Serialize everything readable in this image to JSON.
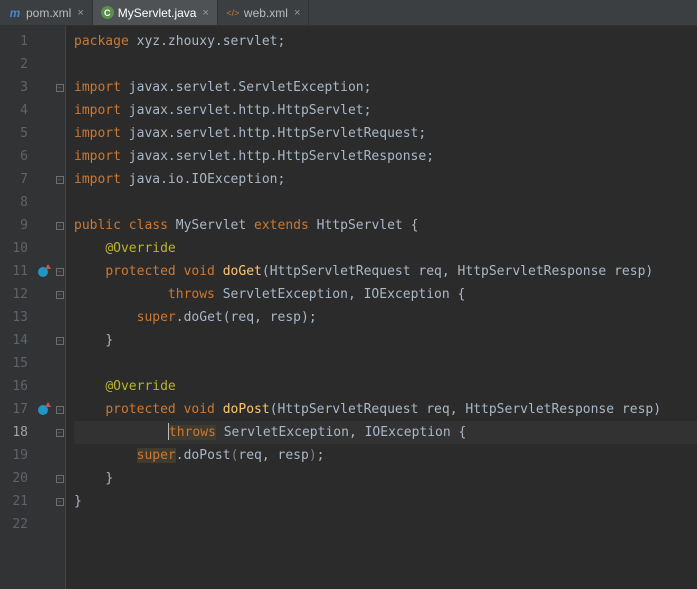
{
  "tabs": [
    {
      "label": "pom.xml",
      "icon": "m",
      "iconColor": "#4a86cf",
      "active": false
    },
    {
      "label": "MyServlet.java",
      "icon": "C",
      "iconColor": "#3b9f5a",
      "active": true
    },
    {
      "label": "web.xml",
      "icon": "xml",
      "iconColor": "#c57633",
      "active": false
    }
  ],
  "currentLine": 18,
  "lines": [
    {
      "n": 1,
      "gutter": "",
      "fold": "",
      "segs": [
        [
          "kw",
          "package "
        ],
        [
          "pkg",
          "xyz.zhouxy.servlet"
        ],
        [
          "punct",
          ";"
        ]
      ]
    },
    {
      "n": 2,
      "gutter": "",
      "fold": "",
      "segs": []
    },
    {
      "n": 3,
      "gutter": "",
      "fold": "fold",
      "segs": [
        [
          "kw",
          "import "
        ],
        [
          "pkg",
          "javax.servlet.ServletException"
        ],
        [
          "punct",
          ";"
        ]
      ]
    },
    {
      "n": 4,
      "gutter": "",
      "fold": "",
      "segs": [
        [
          "kw",
          "import "
        ],
        [
          "pkg",
          "javax.servlet.http.HttpServlet"
        ],
        [
          "punct",
          ";"
        ]
      ]
    },
    {
      "n": 5,
      "gutter": "",
      "fold": "",
      "segs": [
        [
          "kw",
          "import "
        ],
        [
          "pkg",
          "javax.servlet.http.HttpServletRequest"
        ],
        [
          "punct",
          ";"
        ]
      ]
    },
    {
      "n": 6,
      "gutter": "",
      "fold": "",
      "segs": [
        [
          "kw",
          "import "
        ],
        [
          "pkg",
          "javax.servlet.http.HttpServletResponse"
        ],
        [
          "punct",
          ";"
        ]
      ]
    },
    {
      "n": 7,
      "gutter": "",
      "fold": "fold",
      "segs": [
        [
          "kw",
          "import "
        ],
        [
          "pkg",
          "java.io.IOException"
        ],
        [
          "punct",
          ";"
        ]
      ]
    },
    {
      "n": 8,
      "gutter": "",
      "fold": "",
      "segs": []
    },
    {
      "n": 9,
      "gutter": "",
      "fold": "open",
      "segs": [
        [
          "kw",
          "public class "
        ],
        [
          "type",
          "MyServlet "
        ],
        [
          "kw",
          "extends "
        ],
        [
          "type",
          "HttpServlet "
        ],
        [
          "punct",
          "{"
        ]
      ]
    },
    {
      "n": 10,
      "gutter": "",
      "fold": "",
      "segs": [
        [
          "pkg",
          "    "
        ],
        [
          "anno",
          "@Override"
        ]
      ]
    },
    {
      "n": 11,
      "gutter": "override",
      "fold": "open",
      "segs": [
        [
          "pkg",
          "    "
        ],
        [
          "kw",
          "protected void "
        ],
        [
          "fn",
          "doGet"
        ],
        [
          "punct",
          "("
        ],
        [
          "type",
          "HttpServletRequest "
        ],
        [
          "param",
          "req"
        ],
        [
          "punct",
          ", "
        ],
        [
          "type",
          "HttpServletResponse "
        ],
        [
          "param",
          "resp"
        ],
        [
          "punct",
          ")"
        ]
      ]
    },
    {
      "n": 12,
      "gutter": "",
      "fold": "open",
      "segs": [
        [
          "pkg",
          "            "
        ],
        [
          "kw",
          "throws "
        ],
        [
          "type",
          "ServletException"
        ],
        [
          "punct",
          ", "
        ],
        [
          "type",
          "IOException "
        ],
        [
          "punct",
          "{"
        ]
      ]
    },
    {
      "n": 13,
      "gutter": "",
      "fold": "",
      "segs": [
        [
          "pkg",
          "        "
        ],
        [
          "kw",
          "super"
        ],
        [
          "punct",
          "."
        ],
        [
          "pkg",
          "doGet(req"
        ],
        [
          "punct",
          ", "
        ],
        [
          "pkg",
          "resp)"
        ],
        [
          "punct",
          ";"
        ]
      ]
    },
    {
      "n": 14,
      "gutter": "",
      "fold": "close",
      "segs": [
        [
          "pkg",
          "    "
        ],
        [
          "punct",
          "}"
        ]
      ]
    },
    {
      "n": 15,
      "gutter": "",
      "fold": "",
      "segs": []
    },
    {
      "n": 16,
      "gutter": "",
      "fold": "",
      "segs": [
        [
          "pkg",
          "    "
        ],
        [
          "anno",
          "@Override"
        ]
      ]
    },
    {
      "n": 17,
      "gutter": "override",
      "fold": "open",
      "segs": [
        [
          "pkg",
          "    "
        ],
        [
          "kw",
          "protected void "
        ],
        [
          "fn",
          "doPost"
        ],
        [
          "punct",
          "("
        ],
        [
          "type",
          "HttpServletRequest "
        ],
        [
          "param",
          "req"
        ],
        [
          "punct",
          ", "
        ],
        [
          "type",
          "HttpServletResponse "
        ],
        [
          "param",
          "resp"
        ],
        [
          "punct",
          ")"
        ]
      ]
    },
    {
      "n": 18,
      "gutter": "",
      "fold": "open",
      "segs": [
        [
          "pkg",
          "            "
        ],
        [
          "caret",
          ""
        ],
        [
          "hlkw",
          "throws"
        ],
        [
          "pkg",
          " "
        ],
        [
          "type",
          "ServletException"
        ],
        [
          "punct",
          ", "
        ],
        [
          "type",
          "IOException "
        ],
        [
          "punct",
          "{"
        ]
      ]
    },
    {
      "n": 19,
      "gutter": "",
      "fold": "",
      "segs": [
        [
          "pkg",
          "        "
        ],
        [
          "hlkw",
          "super"
        ],
        [
          "punct",
          "."
        ],
        [
          "pkg",
          "doPost"
        ],
        [
          "gray",
          "("
        ],
        [
          "pkg",
          "req"
        ],
        [
          "punct",
          ", "
        ],
        [
          "pkg",
          "resp"
        ],
        [
          "gray",
          ")"
        ],
        [
          "punct",
          ";"
        ]
      ]
    },
    {
      "n": 20,
      "gutter": "",
      "fold": "close",
      "segs": [
        [
          "pkg",
          "    "
        ],
        [
          "punct",
          "}"
        ]
      ]
    },
    {
      "n": 21,
      "gutter": "",
      "fold": "close",
      "segs": [
        [
          "punct",
          "}"
        ]
      ]
    },
    {
      "n": 22,
      "gutter": "",
      "fold": "",
      "segs": []
    }
  ]
}
